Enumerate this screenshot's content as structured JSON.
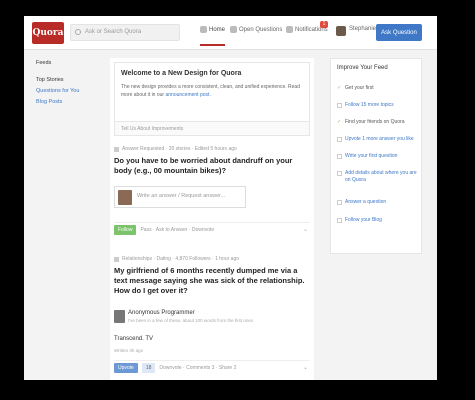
{
  "header": {
    "logo": "Quora",
    "search_placeholder": "Ask or Search Quora",
    "nav": [
      {
        "label": "Home",
        "icon": "home-icon"
      },
      {
        "label": "Open Questions",
        "icon": "pencil-icon"
      },
      {
        "label": "Notifications",
        "icon": "bell-icon"
      }
    ],
    "notif_count": "1",
    "user_name": "Stephanie",
    "ask_button": "Ask Question"
  },
  "leftnav": {
    "feeds_label": "Feeds",
    "items": [
      "Top Stories",
      "Questions for You",
      "Blog Posts"
    ]
  },
  "welcome": {
    "title": "Welcome to a New Design for Quora",
    "body": "The new design provides a more consistent, clean, and unified experience. Read more about it in our",
    "link": "announcement post.",
    "footer": "Tell Us About Improvements"
  },
  "story1": {
    "meta": "Answer Requested · 20 stories · Edited 5 hours ago",
    "question": "Do you have to be worried about dandruff on your body (e.g., 00 mountain bikes)?",
    "answer_placeholder": "Write an answer / Request answer...",
    "answer_button": "Follow",
    "actions": "Pass · Ask to Answer · Downvote"
  },
  "story2": {
    "meta": "Relationships · Dating · 4,870 Followers · 1 hour ago",
    "question": "My girlfriend of 6 months recently dumped me via a text message saying she was sick of the relationship. How do I get over it?",
    "author_name": "Anonymous Programmer",
    "author_cred": "I've been in a few of these, about 100 words from the first ones",
    "answer": "Transcend. TV",
    "views": "Written 4h ago",
    "upvote": "Upvote",
    "upvote_count": "18",
    "actions": "Downvote · Comments 3 · Share 2"
  },
  "sidebar": {
    "title": "Improve Your Feed",
    "items": [
      {
        "label": "Get your first",
        "done": true
      },
      {
        "label": "Follow 15 more topics",
        "done": false
      },
      {
        "label": "Find your friends on Quora",
        "done": true
      },
      {
        "label": "Upvote 1 more answer you like",
        "done": false
      },
      {
        "label": "Write your first question",
        "done": false
      },
      {
        "label": "Add details about where you are on Quora",
        "done": false
      },
      {
        "label": "Answer a question",
        "done": false
      },
      {
        "label": "Follow your Blog",
        "done": false
      }
    ]
  }
}
